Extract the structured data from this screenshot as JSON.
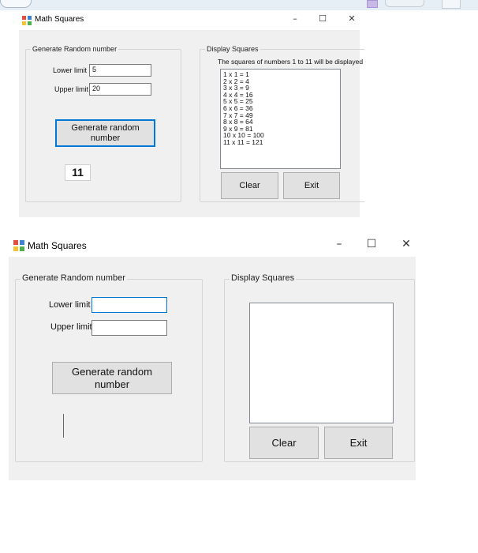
{
  "window_top": {
    "title": "Math Squares",
    "controls": {
      "minimize": "–",
      "maximize": "☐",
      "close": "✕"
    },
    "generate_group": {
      "title": "Generate Random number",
      "lower_label": "Lower limit",
      "lower_value": "5",
      "upper_label": "Upper limit",
      "upper_value": "20",
      "generate_button": "Generate random number",
      "result": "11"
    },
    "display_group": {
      "title": "Display Squares",
      "caption": "The squares of numbers 1 to 11 will be displayed",
      "squares": [
        "1 x 1 = 1",
        "2 x 2 = 4",
        "3 x 3 = 9",
        "4 x 4 = 16",
        "5 x 5 = 25",
        "6 x 6 = 36",
        "7 x 7 = 49",
        "8 x 8 = 64",
        "9 x 9 = 81",
        "10 x 10 = 100",
        "11 x 11 = 121"
      ],
      "clear_button": "Clear",
      "exit_button": "Exit"
    }
  },
  "window_bottom": {
    "title": "Math Squares",
    "controls": {
      "minimize": "–",
      "maximize": "☐",
      "close": "✕"
    },
    "generate_group": {
      "title": "Generate Random number",
      "lower_label": "Lower limit",
      "lower_value": "",
      "upper_label": "Upper limit",
      "upper_value": "",
      "generate_button": "Generate random number"
    },
    "display_group": {
      "title": "Display Squares",
      "clear_button": "Clear",
      "exit_button": "Exit"
    }
  },
  "colors": {
    "form_bg": "#f0f0f0",
    "focus_blue": "#0078d7",
    "button_bg": "#e1e1e1"
  }
}
